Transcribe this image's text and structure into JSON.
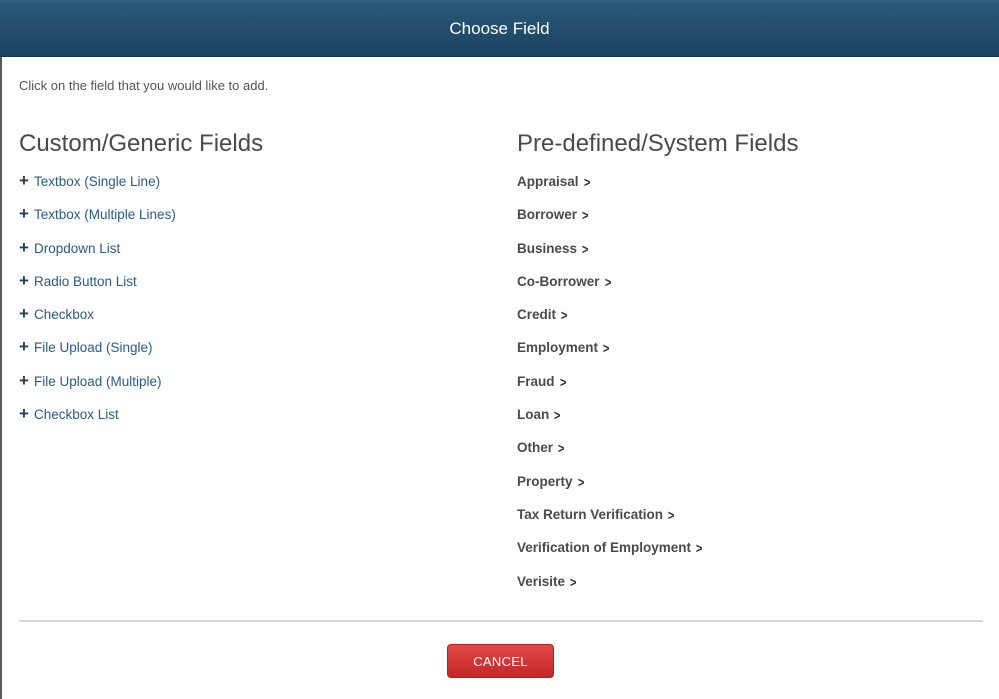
{
  "dialog": {
    "title": "Choose Field",
    "instruction": "Click on the field that you would like to add.",
    "cancel_label": "CANCEL"
  },
  "custom_fields": {
    "title": "Custom/Generic Fields",
    "icon": "plus-icon",
    "items": [
      {
        "label": "Textbox (Single Line)"
      },
      {
        "label": "Textbox (Multiple Lines)"
      },
      {
        "label": "Dropdown List"
      },
      {
        "label": "Radio Button List"
      },
      {
        "label": "Checkbox"
      },
      {
        "label": "File Upload (Single)"
      },
      {
        "label": "File Upload (Multiple)"
      },
      {
        "label": "Checkbox List"
      }
    ]
  },
  "system_fields": {
    "title": "Pre-defined/System Fields",
    "icon": "chevron-right-icon",
    "items": [
      {
        "label": "Appraisal"
      },
      {
        "label": "Borrower"
      },
      {
        "label": "Business"
      },
      {
        "label": "Co-Borrower"
      },
      {
        "label": "Credit"
      },
      {
        "label": "Employment"
      },
      {
        "label": "Fraud"
      },
      {
        "label": "Loan"
      },
      {
        "label": "Other"
      },
      {
        "label": "Property"
      },
      {
        "label": "Tax Return Verification"
      },
      {
        "label": "Verification of Employment"
      },
      {
        "label": "Verisite"
      }
    ]
  },
  "colors": {
    "header_bg": "#1f4765",
    "cancel_bg": "#d43434",
    "link": "#2b5b84"
  }
}
